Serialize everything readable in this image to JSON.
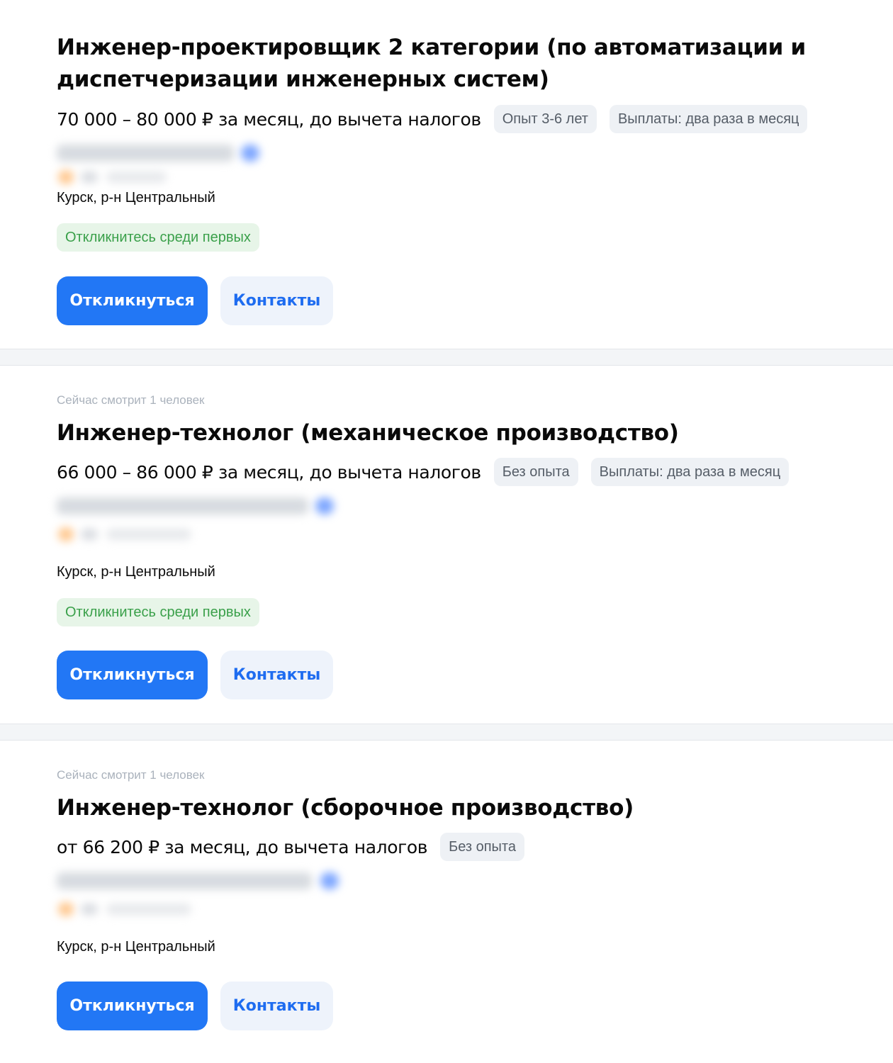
{
  "vacancies": [
    {
      "viewers": "",
      "title": "Инженер-проектировщик 2 категории (по автоматизации и диспетчеризации инженерных систем)",
      "salary": "70 000 – 80 000 ₽ за месяц, до вычета налогов",
      "chips": [
        "Опыт 3-6 лет",
        "Выплаты: два раза в месяц"
      ],
      "location": "Курск, р-н Центральный",
      "first_tag": "Откликнитесь среди первых",
      "apply_label": "Откликнуться",
      "contacts_label": "Контакты"
    },
    {
      "viewers": "Сейчас смотрит 1 человек",
      "title": "Инженер-технолог (механическое производство)",
      "salary": "66 000 – 86 000 ₽ за месяц, до вычета налогов",
      "chips": [
        "Без опыта",
        "Выплаты: два раза в месяц"
      ],
      "location": "Курск, р-н Центральный",
      "first_tag": "Откликнитесь среди первых",
      "apply_label": "Откликнуться",
      "contacts_label": "Контакты"
    },
    {
      "viewers": "Сейчас смотрит 1 человек",
      "title": "Инженер-технолог (сборочное производство)",
      "salary": "от 66 200 ₽ за месяц, до вычета налогов",
      "chips": [
        "Без опыта"
      ],
      "location": "Курск, р-н Центральный",
      "apply_label": "Откликнуться",
      "contacts_label": "Контакты"
    }
  ],
  "colors": {
    "primary_button": "#2277f5",
    "secondary_button_bg": "#eef3fb",
    "first_tag_bg": "#e7f5e8",
    "first_tag_text": "#3aa04a",
    "chip_bg": "#eef1f5"
  }
}
